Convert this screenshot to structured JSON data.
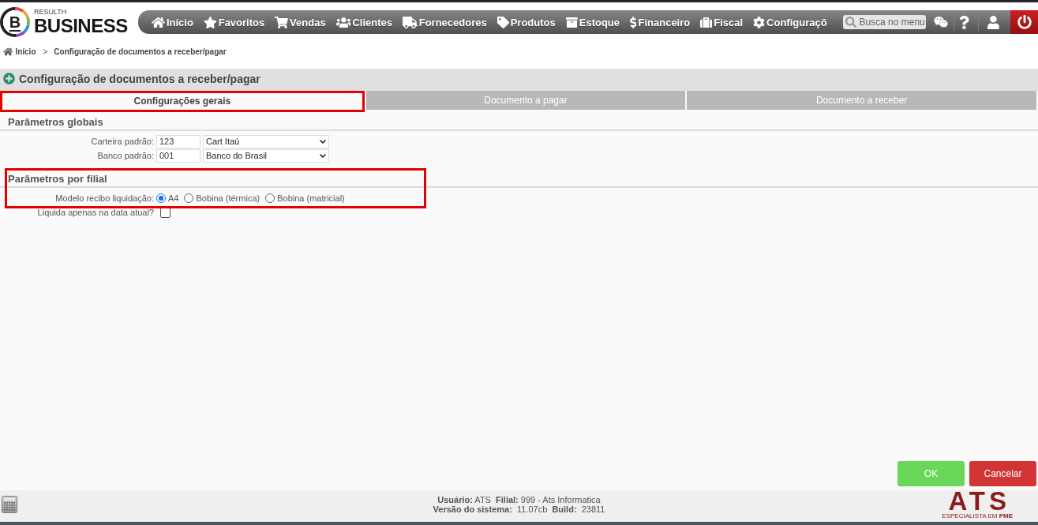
{
  "logo": {
    "mark": "B",
    "tagline": "RESULTH",
    "name": "BUSINESS"
  },
  "nav": {
    "items": [
      {
        "label": "Início"
      },
      {
        "label": "Favoritos"
      },
      {
        "label": "Vendas"
      },
      {
        "label": "Clientes"
      },
      {
        "label": "Fornecedores"
      },
      {
        "label": "Produtos"
      },
      {
        "label": "Estoque"
      },
      {
        "label": "Financeiro"
      },
      {
        "label": "Fiscal"
      },
      {
        "label": "Configuraçõ"
      }
    ],
    "search": {
      "placeholder": "Busca no menu"
    }
  },
  "breadcrumb": {
    "items": [
      "Início",
      "Configuração de documentos a receber/pagar"
    ],
    "separator": ">"
  },
  "page": {
    "title": "Configuração de documentos a receber/pagar"
  },
  "tabs": [
    {
      "label": "Configurações gerais",
      "selected": true,
      "highlighted": true
    },
    {
      "label": "Documento a pagar",
      "selected": false,
      "highlighted": false
    },
    {
      "label": "Documento a receber",
      "selected": false,
      "highlighted": false
    }
  ],
  "sections": [
    {
      "title": "Parâmetros globais",
      "highlighted": false,
      "fields": [
        {
          "kind": "lookup",
          "label": "Carteira padrão:",
          "code": "123",
          "value": "Cart Itaú",
          "highlighted": false
        },
        {
          "kind": "lookup",
          "label": "Banco padrão:",
          "code": "001",
          "value": "Banco do Brasil",
          "highlighted": false
        }
      ]
    },
    {
      "title": "Parâmetros por filial",
      "highlighted": true,
      "fields": [
        {
          "kind": "radio",
          "label": "Modelo recibo liquidação:",
          "highlighted": true,
          "options": [
            {
              "label": "A4",
              "selected": true
            },
            {
              "label": "Bobina (térmica)",
              "selected": false
            },
            {
              "label": "Bobina (matricial)",
              "selected": false
            }
          ]
        },
        {
          "kind": "checkbox",
          "label": "Liquida apenas na data atual?",
          "checked": false,
          "highlighted": false
        }
      ]
    }
  ],
  "actions": [
    {
      "kind": "confirm",
      "label": "OK"
    },
    {
      "kind": "cancel",
      "label": "Cancelar"
    }
  ],
  "status": {
    "lines": [
      "**Usuário:** ATS  **Filial:** 999 - Ats Informatica",
      "**Versão do sistema:**  11.07cb  **Build:**  23811"
    ]
  },
  "brand": {
    "name": "ATS",
    "tagline": "ESPECIALISTA EM **PME**"
  }
}
